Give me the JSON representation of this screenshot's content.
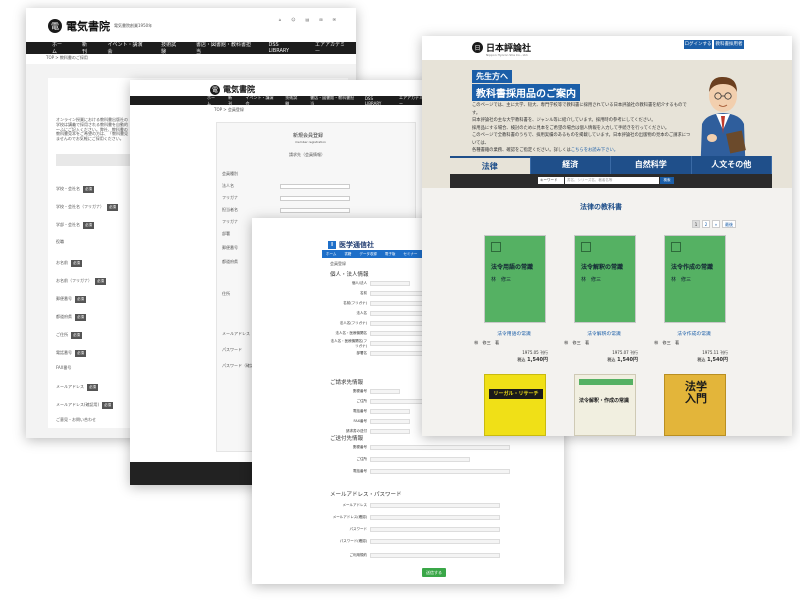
{
  "winA": {
    "brand": "電気書院",
    "brand_sub": "電気書院創業1950年",
    "nav": [
      "ホーム",
      "新刊",
      "イベント・講演会",
      "技術試験",
      "書店・図書館・教科書担当",
      "DSS LIBRARY",
      "エアアカデミー"
    ],
    "breadcrumb": "TOP > 教科書のご採用",
    "intro_lines": [
      "オンライン授業における教科書出版社の",
      "学校は講義で採用される教科書を自動的",
      "〜ふにご記入ください。弊社、教科書の",
      "教科書見本をご希望の方は、「教科書見",
      "ませんのでお気軽にご採用ください。"
    ],
    "fields": [
      {
        "label": "学校・会社名",
        "req": "必須"
      },
      {
        "label": "学校・会社名（フリガナ）",
        "req": "必須"
      },
      {
        "label": "学部・会社名",
        "req": "必須"
      },
      {
        "label": "役職",
        "req": ""
      },
      {
        "label": "お名前",
        "req": "必須"
      },
      {
        "label": "お名前（フリガナ）",
        "req": "必須"
      },
      {
        "label": "郵便番号",
        "req": "必須"
      },
      {
        "label": "都道府県",
        "req": "必須"
      },
      {
        "label": "ご住所",
        "req": "必須"
      },
      {
        "label": "電話番号",
        "req": "必須"
      },
      {
        "label": "FAX番号",
        "req": ""
      },
      {
        "label": "メールアドレス",
        "req": "必須"
      },
      {
        "label": "メールアドレス(確認用)",
        "req": "必須"
      },
      {
        "label": "ご意見・お問い合わせ",
        "req": ""
      }
    ]
  },
  "winB": {
    "brand": "電気書院",
    "nav": [
      "ホーム",
      "新刊",
      "イベント・講演会",
      "技術試験",
      "書店・図書館・教科書担当",
      "DSS LIBRARY",
      "エアアカデミー"
    ],
    "breadcrumb": "TOP > 会員登録",
    "panel_title": "新規会員登録",
    "panel_sub": "member registration",
    "panel_caption": "請求先（会員情報）",
    "labels": [
      "会員種別",
      "法人名",
      "フリガナ",
      "担当者名",
      "フリガナ",
      "部署",
      "郵便番号",
      "都道府県",
      "住所"
    ],
    "lower_labels": [
      "メールアドレス",
      "パスワード",
      "パスワード（確認）"
    ]
  },
  "winC": {
    "brand": "医学通信社",
    "tabs": [
      "ホーム",
      "書籍",
      "データ収録",
      "電子版",
      "セミナー",
      "購入方法",
      "お問い合わせ"
    ],
    "crumb": "会員登録",
    "sections": [
      "個人・法人情報",
      "ご請求先情報",
      "ご送付先情報",
      "メールアドレス・パスワード"
    ],
    "rows1": [
      "個人/法人",
      "名前",
      "名前(フリガナ)",
      "法人名",
      "法人名(フリガナ)",
      "法人名・医療機関名",
      "法人名・医療機関名(フリガナ)",
      "部署名"
    ],
    "rows2": [
      "郵便番号",
      "ご住所",
      "電話番号",
      "FAX番号",
      "請求書の送付"
    ],
    "rows3": [
      "郵便番号",
      "ご住所",
      "電話番号"
    ],
    "rows4": [
      "メールアドレス",
      "メールアドレス(確認)",
      "パスワード",
      "パスワード(確認)",
      "ご利用規約"
    ],
    "submit": "送信する"
  },
  "winD": {
    "brand": "日本評論社",
    "brand_sub": "Nippon Hyoron Sha Co., Ltd.",
    "login": "ログインする",
    "teacher_login": "教科書採用者登録",
    "hero_tag": "先生方へ",
    "hero_title": "教科書採用品のご案内",
    "hero_lines": [
      "このページでは、主に大学、短大、専門学校等で教科書に採用されている日本評論社の教科書を紹介するものです。",
      "日本評論社の主な大学教科書を、ジャンル等に紹介しています。採用時の参考にしてください。",
      "採用品にする場合、検討のために見本をご希望の場合は個人情報を入力して手続きを行ってください。",
      "このページで全教科書のうちで、採用実績のあるものを掲載しています。日本評論社の出版物の見本のご請求については、",
      "各種書籍の業務、確認をご指定ください。詳しくは"
    ],
    "hero_link": "こちらをお読み下さい。",
    "tabs": [
      "法律",
      "経済",
      "自然科学",
      "人文その他"
    ],
    "search": {
      "select": "キーワード",
      "placeholder": "書名、シリーズ名、著者名等",
      "button": "検索"
    },
    "section_title": "法律の教科書",
    "pager": [
      "1",
      "2",
      "»",
      "最後"
    ],
    "books": [
      {
        "title": "法令用語の常識",
        "author": "林　修三　著",
        "date": "1975.05 刊行",
        "price": "1,540円",
        "tax": "税込"
      },
      {
        "title": "法令解釈の常識",
        "author": "林　修三　著",
        "date": "1975.07 刊行",
        "price": "1,540円",
        "tax": "税込"
      },
      {
        "title": "法令作成の常識",
        "author": "林　修三　著",
        "date": "1975.11 刊行",
        "price": "1,540円",
        "tax": "税込"
      }
    ],
    "book_covers": [
      {
        "title": "法令用語の常識",
        "author": "林　修三"
      },
      {
        "title": "法令解釈の常識",
        "author": "林　修三"
      },
      {
        "title": "法令作成の常識",
        "author": "林　修三"
      }
    ],
    "row2_covers": [
      "リーガル・リサーチ",
      "法令解釈・作成の常識",
      "法学入門"
    ],
    "colors": {
      "navy": "#1f4f8a",
      "accent": "#1b5ea8",
      "green": "#55b163",
      "yellow": "#f0e017",
      "tan": "#e3b53a"
    }
  }
}
